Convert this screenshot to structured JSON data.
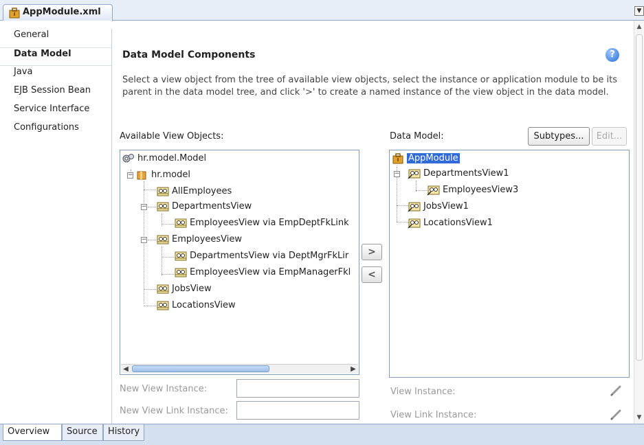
{
  "file_tab": {
    "title": "AppModule.xml"
  },
  "nav": {
    "items": [
      {
        "label": "General",
        "active": false
      },
      {
        "label": "Data Model",
        "active": true
      },
      {
        "label": "Java",
        "active": false
      },
      {
        "label": "EJB Session Bean",
        "active": false
      },
      {
        "label": "Service Interface",
        "active": false
      },
      {
        "label": "Configurations",
        "active": false
      }
    ]
  },
  "main": {
    "title": "Data Model Components",
    "help": "?",
    "description": "Select a view object from the tree of available view objects, select the instance or application module to be its parent in the data model tree, and click '>' to create a named instance of the view object in the data model.",
    "available_label": "Available View Objects:",
    "data_model_label": "Data Model:",
    "subtypes_label": "Subtypes...",
    "edit_label": "Edit...",
    "add_label": ">",
    "remove_label": "<",
    "available_tree": [
      "hr.model.Model",
      "hr.model",
      "AllEmployees",
      "DepartmentsView",
      "EmployeesView via EmpDeptFkLink",
      "EmployeesView",
      "DepartmentsView via DeptMgrFkLir",
      "EmployeesView via EmpManagerFkl",
      "JobsView",
      "LocationsView"
    ],
    "data_model_tree": [
      "AppModule",
      "DepartmentsView1",
      "EmployeesView3",
      "JobsView1",
      "LocationsView1"
    ],
    "new_view_instance_label": "New View Instance:",
    "new_view_link_instance_label": "New View Link Instance:",
    "view_instance_label": "View Instance:",
    "view_link_instance_label": "View Link Instance:"
  },
  "bottom_tabs": [
    {
      "label": "Overview",
      "active": true
    },
    {
      "label": "Source",
      "active": false
    },
    {
      "label": "History",
      "active": false
    }
  ],
  "colors": {
    "selection": "#2f6ad8",
    "tab_border": "#8fa8c8"
  }
}
